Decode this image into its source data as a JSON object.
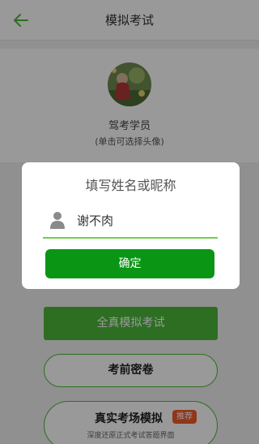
{
  "header": {
    "title": "模拟考试",
    "back_icon": "arrow-left-icon"
  },
  "profile": {
    "name": "驾考学员",
    "hint": "(单击可选择头像)"
  },
  "actions": {
    "simulate_label": "全真模拟考试",
    "secret_label": "考前密卷",
    "real_title": "真实考场模拟",
    "real_badge": "推荐",
    "real_subtitle": "深度还原正式考试答题界面"
  },
  "dialog": {
    "title": "填写姓名或昵称",
    "name_value": "谢不肉",
    "confirm_label": "确定",
    "user_icon": "person-icon"
  },
  "colors": {
    "accent": "#4cb83a",
    "confirm": "#0a9614",
    "badge": "#f25a2a"
  }
}
